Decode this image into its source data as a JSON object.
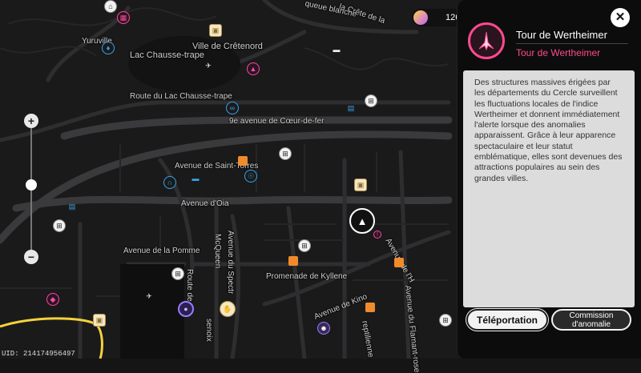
{
  "map": {
    "labels": {
      "yuruville": "Yuruville",
      "crete_top": "la Crête de la",
      "queue_blanche": "queue blanche",
      "lac": "Lac Chausse-trape",
      "ville": "Ville de Crêtenord",
      "route": "Route du Lac Chausse-trape",
      "coeur": "9e avenue de Cœur-de-fer",
      "saint_torres": "Avenue de Saint-Torres",
      "oia": "Avenue d'Oia",
      "pomme": "Avenue de la Pomme",
      "mcqueen": "McQueen",
      "spectr": "Avenue du Spectr",
      "route_de": "Route de",
      "senoix": "senoix",
      "kyllene": "Promenade de Kyllene",
      "kino": "Avenue de Kino",
      "reptilienne": "reptilienne",
      "flamant": "Avenue du Flamant-rose",
      "avenue_h": "Avenue de l'H"
    },
    "zoom": {
      "plus": "+",
      "minus": "−"
    },
    "uid": "UID: 214174956497"
  },
  "currency": {
    "value": "126"
  },
  "panel": {
    "close": "✕",
    "title": "Tour de Wertheimer",
    "subtitle": "Tour de Wertheimer",
    "description": "Des structures massives érigées par les départements du Cercle surveillent les fluctuations locales de l'indice Wertheimer et donnent immédiatement l'alerte lorsque des anomalies apparaissent. Grâce à leur apparence spectaculaire et leur statut emblématique, elles sont devenues des attractions populaires au sein des grandes villes.",
    "teleport_label": "Téléportation",
    "commission_label": "Commission d'anomalie"
  },
  "colors": {
    "accent": "#ff4a8e",
    "route_highlight": "#f5d23c",
    "water_icon": "#3aa3e6"
  }
}
